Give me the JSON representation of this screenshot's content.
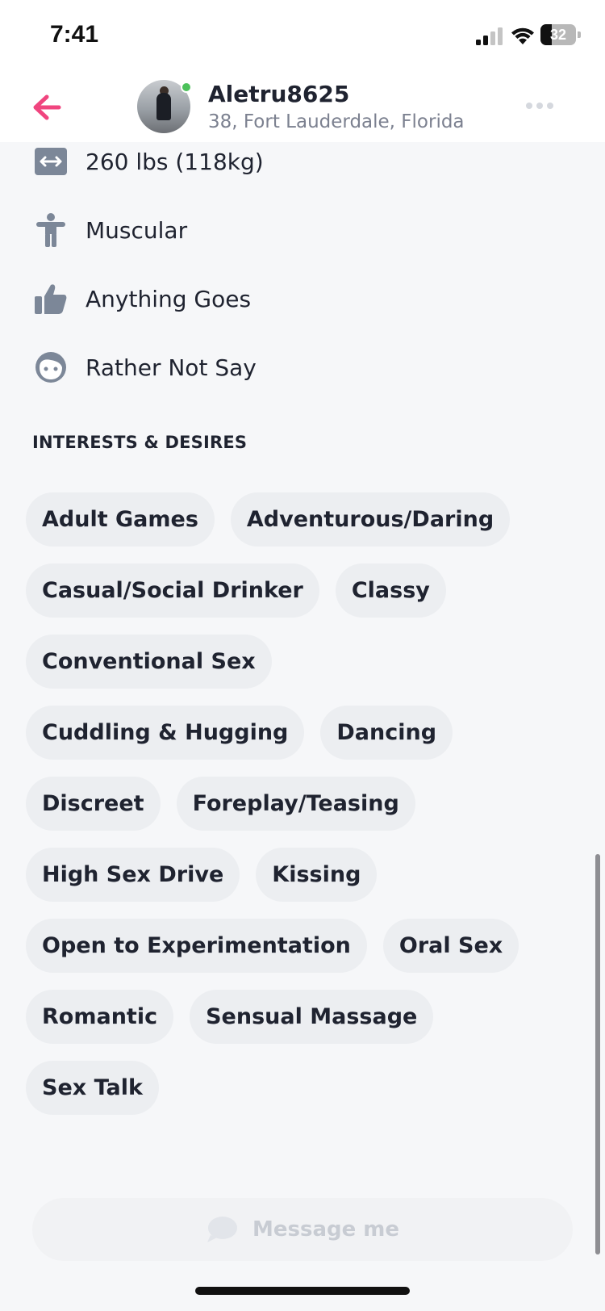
{
  "status_bar": {
    "time": "7:41",
    "battery": "32",
    "battery_level": 0.32
  },
  "header": {
    "name": "Aletru8625",
    "meta": "38, Fort Lauderdale, Florida",
    "online": true,
    "accent_color": "#f0457f",
    "online_color": "#4cc15a"
  },
  "attributes": [
    {
      "icon": "weight-icon",
      "label": "260 lbs (118kg)"
    },
    {
      "icon": "body-type-icon",
      "label": "Muscular"
    },
    {
      "icon": "thumbs-up-icon",
      "label": "Anything Goes"
    },
    {
      "icon": "face-icon",
      "label": "Rather Not Say"
    }
  ],
  "interests": {
    "title": "INTERESTS & DESIRES",
    "items": [
      "Adult Games",
      "Adventurous/Daring",
      "Casual/Social Drinker",
      "Classy",
      "Conventional Sex",
      "Cuddling & Hugging",
      "Dancing",
      "Discreet",
      "Foreplay/Teasing",
      "High Sex Drive",
      "Kissing",
      "Open to Experimentation",
      "Oral Sex",
      "Romantic",
      "Sensual Massage",
      "Sex Talk"
    ]
  },
  "message": {
    "label": "Message me",
    "icon": "chat-bubble-icon"
  }
}
